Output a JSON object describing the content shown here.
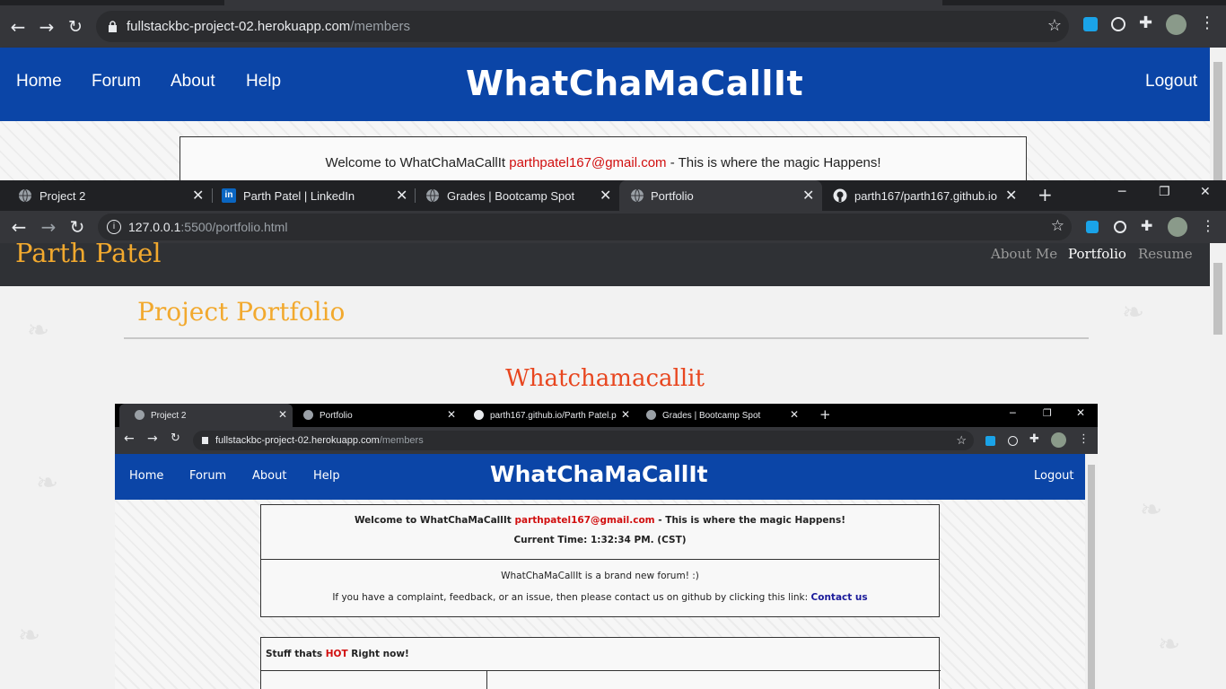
{
  "back_window": {
    "url_host": "fullstackbc-project-02.herokuapp.com",
    "url_path": "/members",
    "navbar": {
      "links": [
        "Home",
        "Forum",
        "About",
        "Help"
      ],
      "brand": "WhatChaMaCallIt",
      "logout": "Logout"
    },
    "welcome": {
      "prefix": "Welcome to WhatChaMaCallIt ",
      "email": "parthpatel167@gmail.com",
      "suffix": " - This is where the magic Happens!"
    }
  },
  "front_window": {
    "tabs": [
      {
        "label": "Project 2",
        "icon": "globe-icon"
      },
      {
        "label": "Parth Patel | LinkedIn",
        "icon": "linkedin-icon"
      },
      {
        "label": "Grades | Bootcamp Spot",
        "icon": "globe-icon"
      },
      {
        "label": "Portfolio",
        "icon": "globe-icon",
        "active": true
      },
      {
        "label": "parth167/parth167.github.io",
        "icon": "github-icon"
      }
    ],
    "url_host": "127.0.0.1",
    "url_path": ":5500/portfolio.html",
    "portfolio": {
      "name": "Parth Patel",
      "nav": [
        "About Me",
        "Portfolio",
        "Resume"
      ],
      "section_title": "Project Portfolio",
      "project_title": "Whatchamacallit"
    }
  },
  "screenshot": {
    "tabs": [
      "Project 2",
      "Portfolio",
      "parth167.github.io/Parth Patel.p",
      "Grades | Bootcamp Spot"
    ],
    "url_host": "fullstackbc-project-02.herokuapp.com",
    "url_path": "/members",
    "navbar": {
      "links": [
        "Home",
        "Forum",
        "About",
        "Help"
      ],
      "brand": "WhatChaMaCallIt",
      "logout": "Logout"
    },
    "welcome": {
      "prefix": "Welcome to WhatChaMaCallIt ",
      "email": "parthpatel167@gmail.com",
      "suffix": " - This is where the magic Happens!",
      "time": "Current Time: 1:32:34 PM. (CST)"
    },
    "info": {
      "line1": "WhatChaMaCallIt is a brand new forum! :)",
      "line2": "If you have a complaint, feedback, or an issue, then please contact us on github by clicking this link: ",
      "contact": "Contact us"
    },
    "hot": {
      "prefix": "Stuff thats ",
      "hot": "HOT",
      "suffix": " Right now!"
    }
  },
  "colors": {
    "navbar_blue": "#0b45a7",
    "portfolio_orange": "#f2a92e",
    "project_title_red": "#e8461f",
    "email_red": "#d10f0f"
  }
}
